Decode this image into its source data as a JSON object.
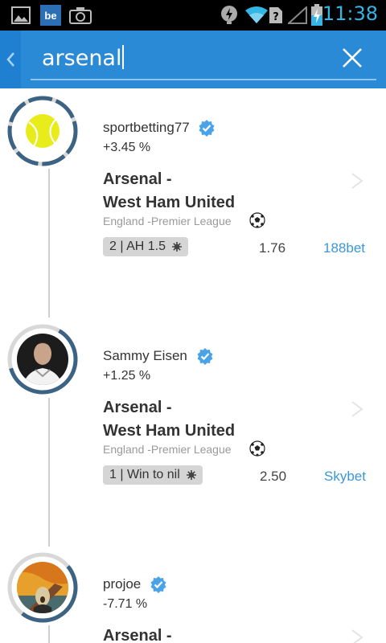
{
  "status_bar": {
    "time": "11:38",
    "icons": [
      "image-icon",
      "behance-icon",
      "camera-icon",
      "notification-icon",
      "wifi-icon",
      "sim-unknown-icon",
      "signal-icon",
      "battery-charging-icon"
    ]
  },
  "search": {
    "query": "arsenal"
  },
  "colors": {
    "accent": "#33b5e5",
    "action_bar": "#1f7fd1",
    "link": "#3a97d6",
    "verified": "#4aa3e8"
  },
  "tips": [
    {
      "username": "sportbetting77",
      "roi": "+3.45 %",
      "match_line1": "Arsenal -",
      "match_line2": "West Ham United",
      "league": "England -Premier League",
      "bet": "2 | AH 1.5",
      "odds": "1.76",
      "bookmaker": "188bet",
      "avatar": "tennis-ball-avatar"
    },
    {
      "username": "Sammy Eisen",
      "roi": "+1.25 %",
      "match_line1": "Arsenal -",
      "match_line2": "West Ham United",
      "league": "England -Premier League",
      "bet": "1 | Win to nil",
      "odds": "2.50",
      "bookmaker": "Skybet",
      "avatar": "player-photo-avatar"
    },
    {
      "username": "projoe",
      "roi": "-7.71 %",
      "match_line1": "Arsenal -",
      "avatar": "scream-painting-avatar"
    }
  ]
}
